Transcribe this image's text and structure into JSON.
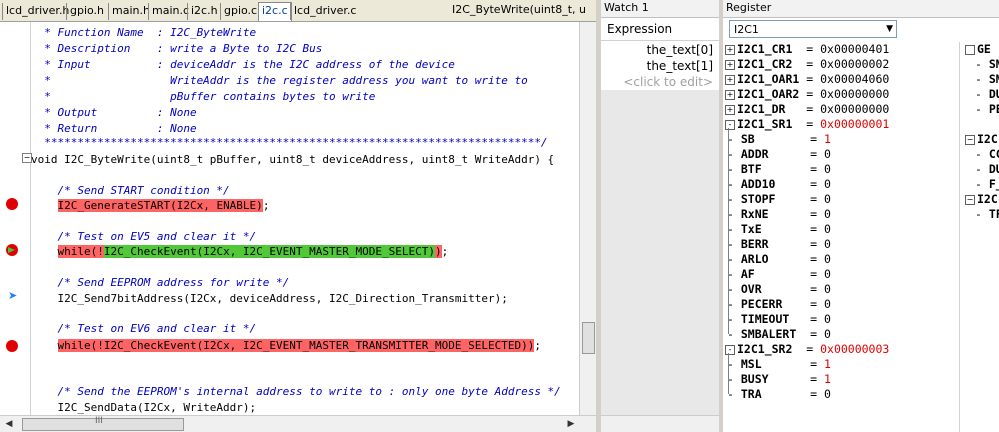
{
  "editor": {
    "tabs": [
      "lcd_driver.h",
      "gpio.h",
      "main.h",
      "main.c",
      "i2c.h",
      "gpio.c",
      "i2c.c",
      "lcd_driver.c"
    ],
    "active_tab": "i2c.c",
    "function_selector": "I2C_ByteWrite(uint8_t, u",
    "lines": [
      {
        "text": "  * Function Name  : I2C_ByteWrite",
        "style": "comment"
      },
      {
        "text": "  * Description    : write a Byte to I2C Bus",
        "style": "comment"
      },
      {
        "text": "  * Input          : deviceAddr is the I2C address of the device",
        "style": "comment"
      },
      {
        "text": "  *                  WriteAddr is the register address you want to write to",
        "style": "comment"
      },
      {
        "text": "  *                  pBuffer contains bytes to write",
        "style": "comment"
      },
      {
        "text": "  * Output         : None",
        "style": "comment"
      },
      {
        "text": "  * Return         : None",
        "style": "comment"
      },
      {
        "text": "  ***************************************************************************/",
        "style": "comment"
      },
      {
        "text": "void I2C_ByteWrite(uint8_t pBuffer, uint8_t deviceAddress, uint8_t WriteAddr) {",
        "style": "code"
      },
      {
        "text": "",
        "style": "code"
      },
      {
        "text": "    /* Send START condition */",
        "style": "comment"
      },
      {
        "text": "    I2C_GenerateSTART(I2Cx, ENABLE);",
        "style": "code"
      },
      {
        "text": "",
        "style": "code"
      },
      {
        "text": "    /* Test on EV5 and clear it */",
        "style": "comment"
      },
      {
        "text": "    while(!I2C_CheckEvent(I2Cx, I2C_EVENT_MASTER_MODE_SELECT));",
        "style": "code"
      },
      {
        "text": "",
        "style": "code"
      },
      {
        "text": "    /* Send EEPROM address for write */",
        "style": "comment"
      },
      {
        "text": "    I2C_Send7bitAddress(I2Cx, deviceAddress, I2C_Direction_Transmitter);",
        "style": "code"
      },
      {
        "text": "",
        "style": "code"
      },
      {
        "text": "    /* Test on EV6 and clear it */",
        "style": "comment"
      },
      {
        "text": "    while(!I2C_CheckEvent(I2Cx, I2C_EVENT_MASTER_TRANSMITTER_MODE_SELECTED));",
        "style": "code"
      },
      {
        "text": "",
        "style": "code"
      },
      {
        "text": "",
        "style": "code"
      },
      {
        "text": "    /* Send the EEPROM's internal address to write to : only one byte Address */",
        "style": "comment"
      },
      {
        "text": "    I2C_SendData(I2Cx, WriteAddr);",
        "style": "code"
      }
    ],
    "highlights": {
      "start_call": "I2C_GenerateSTART(I2Cx, ENABLE)",
      "ev5_while_kw": "while(!",
      "ev5_call": "I2C_CheckEvent(I2Cx, I2C_EVENT_MASTER_MODE_SELECT)",
      "ev5_tail": ")",
      "ev6_call": "while(!I2C_CheckEvent(I2Cx, I2C_EVENT_MASTER_TRANSMITTER_MODE_SELECTED))"
    },
    "scroll_grip": "III"
  },
  "watch": {
    "title": "Watch 1",
    "column": "Expression",
    "items": [
      "the_text[0]",
      "the_text[1]"
    ],
    "placeholder": "<click to edit>"
  },
  "register": {
    "title": "Register",
    "selected_peripheral": "I2C1",
    "rows": [
      {
        "name": "I2C1_CR1 ",
        "value": "0x00000401",
        "red": false,
        "expander": "+"
      },
      {
        "name": "I2C1_CR2 ",
        "value": "0x00000002",
        "red": false,
        "expander": "+"
      },
      {
        "name": "I2C1_OAR1",
        "value": "0x00004060",
        "red": false,
        "expander": "+"
      },
      {
        "name": "I2C1_OAR2",
        "value": "0x00000000",
        "red": false,
        "expander": "+"
      },
      {
        "name": "I2C1_DR  ",
        "value": "0x00000000",
        "red": false,
        "expander": "+"
      },
      {
        "name": "I2C1_SR1 ",
        "value": "0x00000001",
        "red": true,
        "expander": "-"
      },
      {
        "name": "SB      ",
        "value": "1",
        "red": true,
        "child": true
      },
      {
        "name": "ADDR    ",
        "value": "0",
        "red": false,
        "child": true
      },
      {
        "name": "BTF     ",
        "value": "0",
        "red": false,
        "child": true
      },
      {
        "name": "ADD10   ",
        "value": "0",
        "red": false,
        "child": true
      },
      {
        "name": "STOPF   ",
        "value": "0",
        "red": false,
        "child": true
      },
      {
        "name": "RxNE    ",
        "value": "0",
        "red": false,
        "child": true
      },
      {
        "name": "TxE     ",
        "value": "0",
        "red": false,
        "child": true
      },
      {
        "name": "BERR    ",
        "value": "0",
        "red": false,
        "child": true
      },
      {
        "name": "ARLO    ",
        "value": "0",
        "red": false,
        "child": true
      },
      {
        "name": "AF      ",
        "value": "0",
        "red": false,
        "child": true
      },
      {
        "name": "OVR     ",
        "value": "0",
        "red": false,
        "child": true
      },
      {
        "name": "PECERR  ",
        "value": "0",
        "red": false,
        "child": true
      },
      {
        "name": "TIMEOUT ",
        "value": "0",
        "red": false,
        "child": true
      },
      {
        "name": "SMBALERT",
        "value": "0",
        "red": false,
        "child": true
      },
      {
        "name": "I2C1_SR2 ",
        "value": "0x00000003",
        "red": true,
        "expander": "-"
      },
      {
        "name": "MSL     ",
        "value": "1",
        "red": true,
        "child": true
      },
      {
        "name": "BUSY    ",
        "value": "1",
        "red": true,
        "child": true
      },
      {
        "name": "TRA     ",
        "value": "0",
        "red": false,
        "child": true
      }
    ],
    "right_tree": [
      "GE",
      "SM",
      "SM",
      "DU",
      "PE",
      "I2C",
      "CC",
      "DU",
      "F_",
      "I2C",
      "TF"
    ]
  }
}
